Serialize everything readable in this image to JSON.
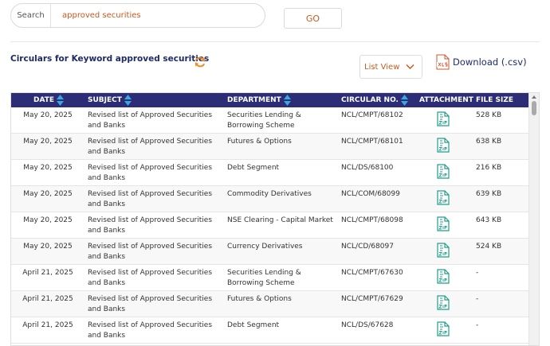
{
  "search": {
    "label": "Search",
    "value": "approved securities",
    "go_label": "GO"
  },
  "results": {
    "title": "Circulars for Keyword approved securities",
    "view_label": "List View",
    "download_label": "Download (.csv)"
  },
  "icons": {
    "refresh": "refresh-icon",
    "view_dropdown": "chevron-down-icon",
    "download": "xls-file-icon",
    "attachment": "zip-file-icon",
    "sort": "sort-icon"
  },
  "colors": {
    "header_bg": "#2d2c77",
    "accent_orange": "#c85a1e",
    "title_navy": "#1d2a6b",
    "sort_arrow": "#3aa8e0",
    "attachment_green": "#1f9e8a"
  },
  "table": {
    "columns": [
      "DATE",
      "SUBJECT",
      "DEPARTMENT",
      "CIRCULAR NO.",
      "ATTACHMENT",
      "FILE SIZE"
    ],
    "rows": [
      {
        "date": "May 20, 2025",
        "subject": "Revised list of Approved Securities and Banks",
        "department": "Securities Lending & Borrowing Scheme",
        "circular": "NCL/CMPT/68102",
        "size": "528 KB"
      },
      {
        "date": "May 20, 2025",
        "subject": "Revised list of Approved Securities and Banks",
        "department": "Futures & Options",
        "circular": "NCL/CMPT/68101",
        "size": "638 KB"
      },
      {
        "date": "May 20, 2025",
        "subject": "Revised list of Approved Securities and Banks",
        "department": "Debt Segment",
        "circular": "NCL/DS/68100",
        "size": "216 KB"
      },
      {
        "date": "May 20, 2025",
        "subject": "Revised list of Approved Securities and Banks",
        "department": "Commodity Derivatives",
        "circular": "NCL/COM/68099",
        "size": "639 KB"
      },
      {
        "date": "May 20, 2025",
        "subject": "Revised list of Approved Securities and Banks",
        "department": "NSE Clearing - Capital Market",
        "circular": "NCL/CMPT/68098",
        "size": "643 KB"
      },
      {
        "date": "May 20, 2025",
        "subject": "Revised list of Approved Securities and Banks",
        "department": "Currency Derivatives",
        "circular": "NCL/CD/68097",
        "size": "524 KB"
      },
      {
        "date": "April 21, 2025",
        "subject": "Revised list of Approved Securities and Banks",
        "department": "Securities Lending & Borrowing Scheme",
        "circular": "NCL/CMPT/67630",
        "size": "-"
      },
      {
        "date": "April 21, 2025",
        "subject": "Revised list of Approved Securities and Banks",
        "department": "Futures & Options",
        "circular": "NCL/CMPT/67629",
        "size": "-"
      },
      {
        "date": "April 21, 2025",
        "subject": "Revised list of Approved Securities and Banks",
        "department": "Debt Segment",
        "circular": "NCL/DS/67628",
        "size": "-"
      }
    ]
  }
}
